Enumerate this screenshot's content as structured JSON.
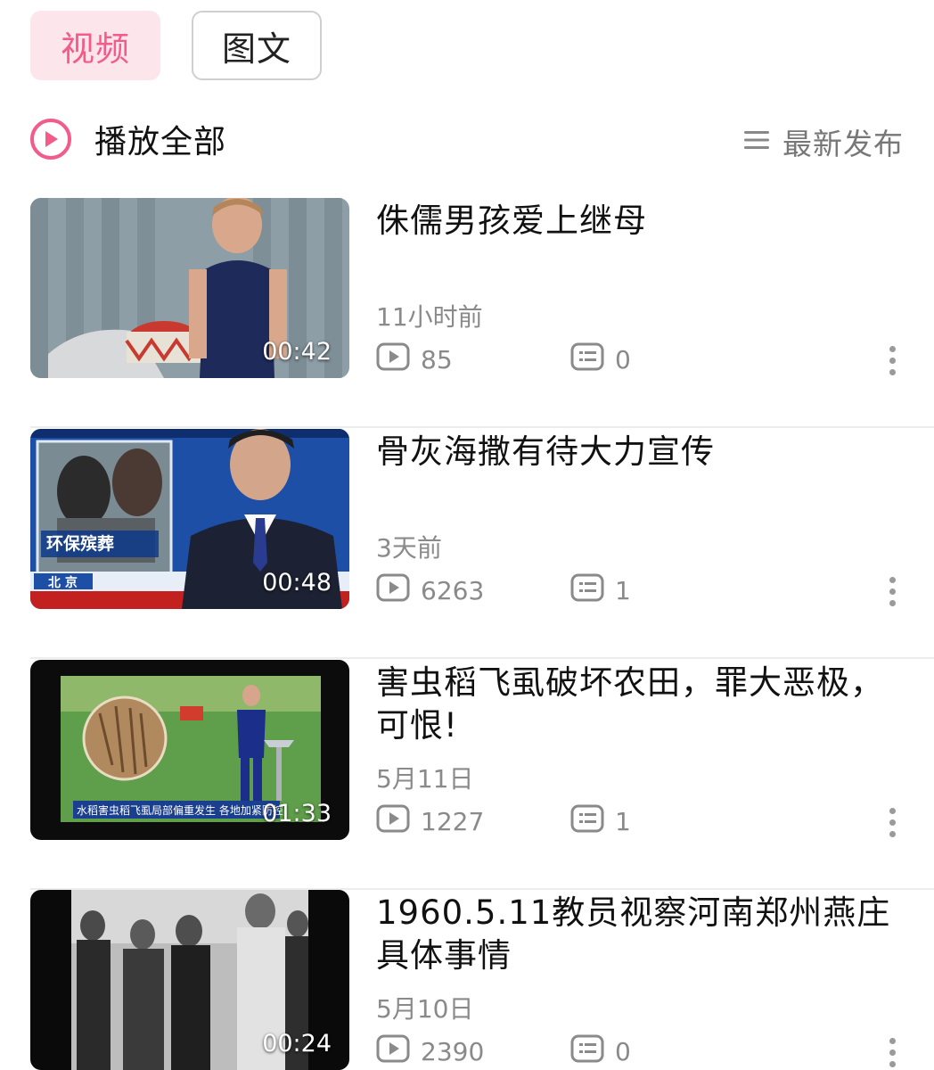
{
  "tabs": [
    {
      "label": "视频",
      "active": true
    },
    {
      "label": "图文",
      "active": false
    }
  ],
  "toolbar": {
    "play_all_label": "播放全部",
    "sort_label": "最新发布"
  },
  "colors": {
    "accent": "#f25b8a",
    "accent_bg": "#fce6ec",
    "meta_text": "#8a8a8a"
  },
  "videos": [
    {
      "title": "侏儒男孩爱上继母",
      "date": "11小时前",
      "duration": "00:42",
      "views": "85",
      "comments": "0"
    },
    {
      "title": "骨灰海撒有待大力宣传",
      "date": "3天前",
      "duration": "00:48",
      "views": "6263",
      "comments": "1",
      "thumb_text": [
        "环保殡葬",
        "北 京"
      ]
    },
    {
      "title": "害虫稻飞虱破坏农田，罪大恶极，可恨!",
      "date": "5月11日",
      "duration": "01:33",
      "views": "1227",
      "comments": "1",
      "thumb_text": [
        "水稻害虫稻飞虱局部偏重发生 各地加紧防控"
      ]
    },
    {
      "title": "1960.5.11教员视察河南郑州燕庄具体事情",
      "date": "5月10日",
      "duration": "00:24",
      "views": "2390",
      "comments": "0"
    }
  ]
}
